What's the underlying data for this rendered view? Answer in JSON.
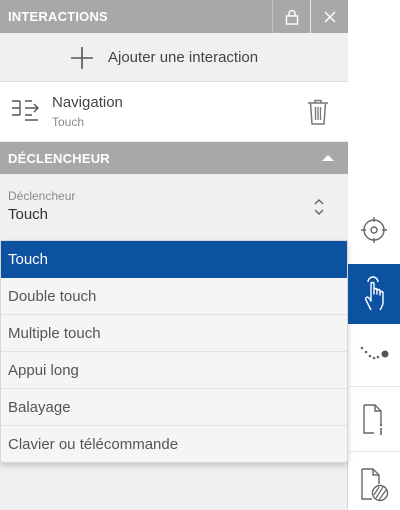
{
  "header": {
    "title": "INTERACTIONS"
  },
  "add_interaction": {
    "label": "Ajouter une interaction"
  },
  "interaction": {
    "title": "Navigation",
    "subtitle": "Touch"
  },
  "trigger_section": {
    "title": "DÉCLENCHEUR"
  },
  "trigger_field": {
    "label": "Déclencheur",
    "value": "Touch"
  },
  "dropdown": {
    "options": [
      "Touch",
      "Double touch",
      "Multiple touch",
      "Appui long",
      "Balayage",
      "Clavier ou télécommande"
    ],
    "selected_index": 0
  },
  "toolbar": {
    "buttons": [
      "target-icon",
      "touch-gesture-icon",
      "path-dots-icon",
      "document-info-icon",
      "document-style-icon"
    ],
    "active": "touch-gesture-icon"
  },
  "colors": {
    "accent": "#0d51a1",
    "header_bg": "#a8a8a8"
  }
}
